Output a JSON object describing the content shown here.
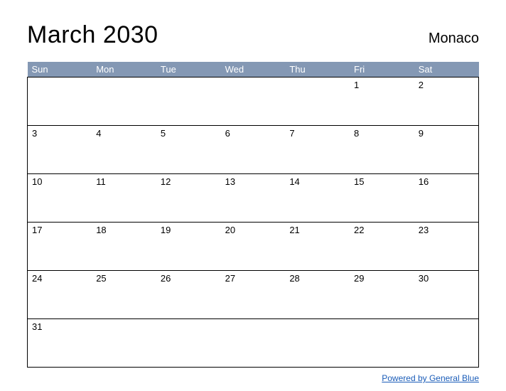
{
  "header": {
    "title": "March 2030",
    "region": "Monaco"
  },
  "days": [
    "Sun",
    "Mon",
    "Tue",
    "Wed",
    "Thu",
    "Fri",
    "Sat"
  ],
  "weeks": [
    [
      "",
      "",
      "",
      "",
      "",
      "1",
      "2"
    ],
    [
      "3",
      "4",
      "5",
      "6",
      "7",
      "8",
      "9"
    ],
    [
      "10",
      "11",
      "12",
      "13",
      "14",
      "15",
      "16"
    ],
    [
      "17",
      "18",
      "19",
      "20",
      "21",
      "22",
      "23"
    ],
    [
      "24",
      "25",
      "26",
      "27",
      "28",
      "29",
      "30"
    ],
    [
      "31",
      "",
      "",
      "",
      "",
      "",
      ""
    ]
  ],
  "footer": {
    "powered_by": "Powered by General Blue"
  }
}
